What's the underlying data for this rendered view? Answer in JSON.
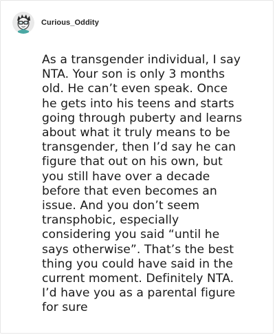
{
  "post": {
    "username": "Curious_Oddity",
    "avatar_icon": "avatar-character-icon",
    "comment_text": "As a transgender individual, I say\nNTA. Your son is only 3 months\nold. He can’t even speak. Once\nhe gets into his teens and starts\ngoing through puberty and learns\nabout what it truly means to be\ntransgender, then I’d say he can\nfigure that out on his own, but\nyou still have over a decade\nbefore that even becomes an\nissue. And you don’t seem\ntransphobic, especially\nconsidering you said “until he\nsays otherwise”. That’s the best\nthing you could have said in the\ncurrent moment. Definitely NTA.\nI’d have you as a parental figure\nfor sure"
  },
  "colors": {
    "background": "#ffffff",
    "border": "#e6e6e6",
    "text": "#1a1a1a",
    "username": "#222222"
  }
}
